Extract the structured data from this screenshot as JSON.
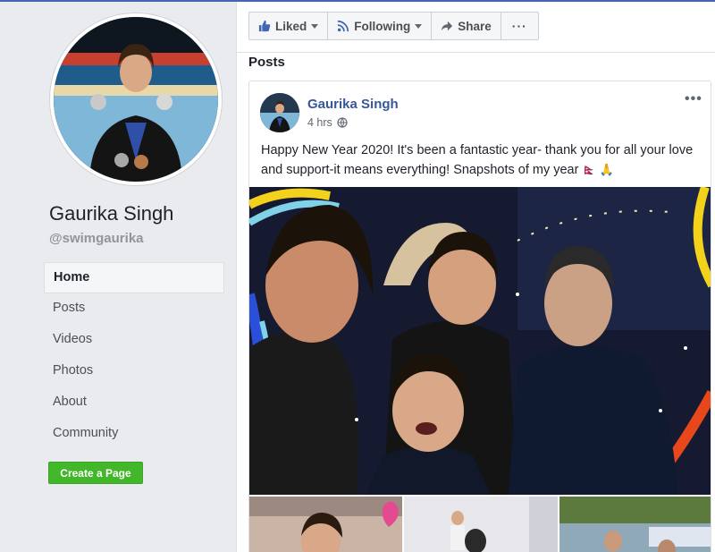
{
  "page": {
    "name": "Gaurika Singh",
    "handle": "@swimgaurika"
  },
  "nav": {
    "items": [
      {
        "label": "Home",
        "active": true
      },
      {
        "label": "Posts"
      },
      {
        "label": "Videos"
      },
      {
        "label": "Photos"
      },
      {
        "label": "About"
      },
      {
        "label": "Community"
      }
    ]
  },
  "create_page_label": "Create a Page",
  "actions": {
    "liked": "Liked",
    "following": "Following",
    "share": "Share",
    "more": "···"
  },
  "posts_heading": "Posts",
  "post": {
    "author": "Gaurika Singh",
    "time": "4 hrs",
    "more": "•••",
    "text": "Happy New Year 2020! It's been a fantastic year- thank you for all your love and support-it means everything! Snapshots of my year",
    "emoji_flag": "🇳🇵",
    "emoji_pray": "🙏"
  },
  "colors": {
    "brand_blue": "#4267b2",
    "link_blue": "#365899",
    "create_green": "#42b72a",
    "background": "#e9ebee"
  },
  "icons": {
    "liked": "thumbs-up-icon",
    "following": "rss-feed-icon",
    "share": "share-arrow-icon",
    "privacy": "globe-icon"
  }
}
